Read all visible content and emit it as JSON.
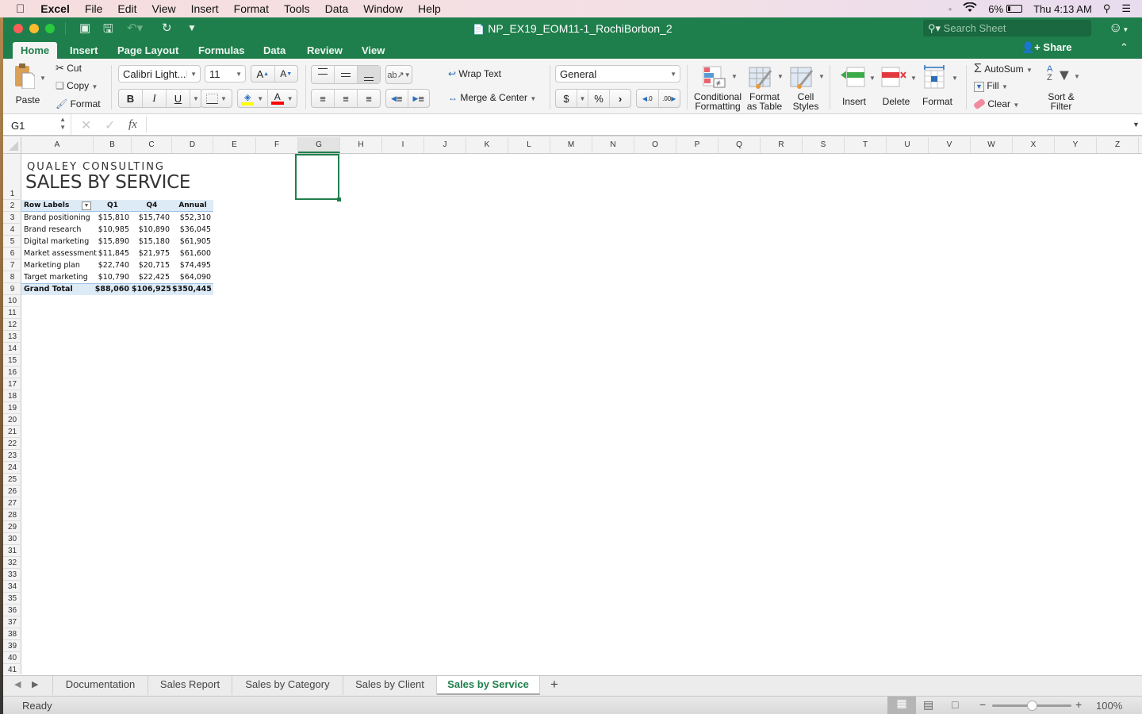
{
  "menubar": {
    "apple_icon": "apple-logo",
    "app_name": "Excel",
    "items": [
      "File",
      "Edit",
      "View",
      "Insert",
      "Format",
      "Tools",
      "Data",
      "Window",
      "Help"
    ],
    "battery": "6%",
    "clock": "Thu 4:13 AM"
  },
  "window": {
    "title": "NP_EX19_EOM11-1_RochiBorbon_2",
    "search_placeholder": "Search Sheet",
    "share_label": "Share"
  },
  "ribbon_tabs": [
    {
      "label": "Home",
      "active": true
    },
    {
      "label": "Insert"
    },
    {
      "label": "Page Layout"
    },
    {
      "label": "Formulas"
    },
    {
      "label": "Data"
    },
    {
      "label": "Review"
    },
    {
      "label": "View"
    }
  ],
  "ribbon": {
    "paste": "Paste",
    "cut": "Cut",
    "copy": "Copy",
    "format_painter": "Format",
    "font_name": "Calibri Light...",
    "font_size": "11",
    "bold": "B",
    "italic": "I",
    "underline": "U",
    "wrap_text": "Wrap Text",
    "merge_center": "Merge & Center",
    "number_format": "General",
    "currency": "$",
    "percent": "%",
    "comma": "›",
    "cond_format_1": "Conditional",
    "cond_format_2": "Formatting",
    "format_table_1": "Format",
    "format_table_2": "as Table",
    "cell_styles_1": "Cell",
    "cell_styles_2": "Styles",
    "insert": "Insert",
    "delete": "Delete",
    "format": "Format",
    "autosum": "AutoSum",
    "fill": "Fill",
    "clear": "Clear",
    "sort_filter_1": "Sort &",
    "sort_filter_2": "Filter",
    "fill_color": "#ffff00",
    "font_color": "#ff0000"
  },
  "formula_bar": {
    "name_box": "G1",
    "fx": "fx",
    "formula": ""
  },
  "columns": [
    "A",
    "B",
    "C",
    "D",
    "E",
    "F",
    "G",
    "H",
    "I",
    "J",
    "K",
    "L",
    "M",
    "N",
    "O",
    "P",
    "Q",
    "R",
    "S",
    "T",
    "U",
    "V",
    "W",
    "X",
    "Y",
    "Z"
  ],
  "selected_column": "G",
  "sheet": {
    "company": "QUALEY CONSULTING",
    "title": "SALES BY SERVICE",
    "pivot": {
      "headers": [
        "Row Labels",
        "Q1",
        "Q4",
        "Annual"
      ],
      "rows": [
        [
          "Brand positioning",
          "$15,810",
          "$15,740",
          "$52,310"
        ],
        [
          "Brand research",
          "$10,985",
          "$10,890",
          "$36,045"
        ],
        [
          "Digital marketing",
          "$15,890",
          "$15,180",
          "$61,905"
        ],
        [
          "Market assessment",
          "$11,845",
          "$21,975",
          "$61,600"
        ],
        [
          "Marketing plan",
          "$22,740",
          "$20,715",
          "$74,495"
        ],
        [
          "Target marketing",
          "$10,790",
          "$22,425",
          "$64,090"
        ]
      ],
      "total": [
        "Grand Total",
        "$88,060",
        "$106,925",
        "$350,445"
      ]
    }
  },
  "sheet_tabs": [
    {
      "label": "Documentation"
    },
    {
      "label": "Sales Report"
    },
    {
      "label": "Sales by Category"
    },
    {
      "label": "Sales by Client"
    },
    {
      "label": "Sales by Service",
      "active": true
    }
  ],
  "status": {
    "text": "Ready",
    "zoom": "100%",
    "zoom_level_fraction": 0.5
  },
  "colors": {
    "accent": "#1f7f4c",
    "pivot_header_bg": "#ddebf7",
    "pivot_total_bg": "#ddebf7"
  }
}
